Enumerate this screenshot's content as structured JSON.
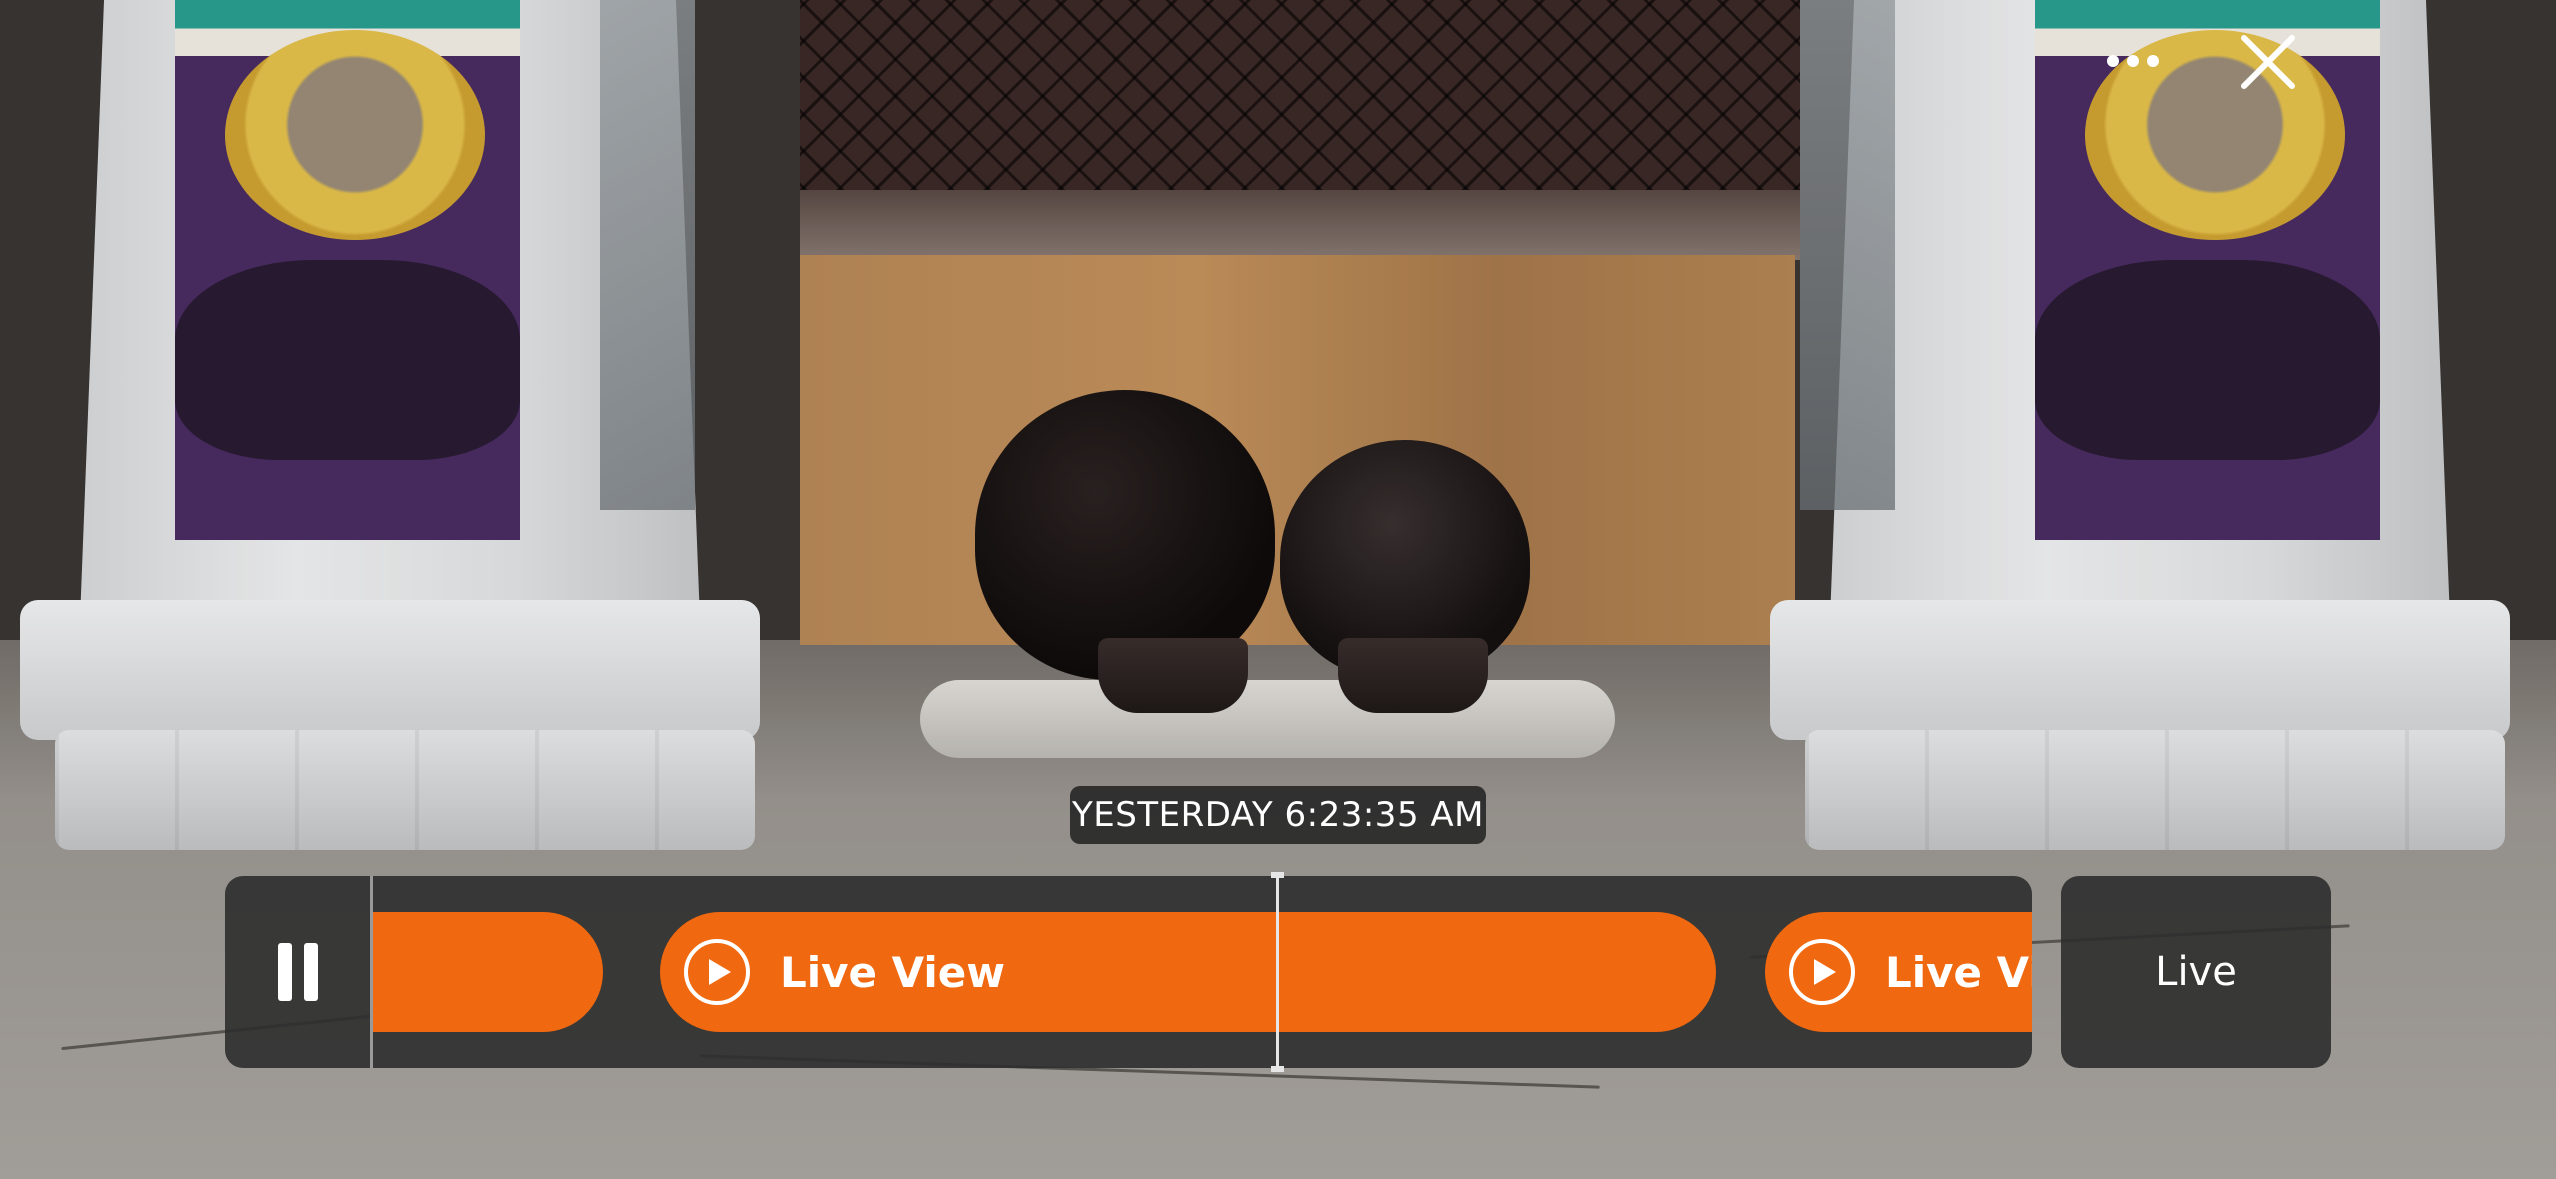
{
  "player": {
    "timestamp": "YESTERDAY 6:23:35 AM",
    "live_button_label": "Live",
    "accent_color": "#f0680f"
  },
  "timeline": {
    "clips": [
      {
        "label": ""
      },
      {
        "label": "Live View"
      },
      {
        "label": "Live Vi"
      }
    ]
  },
  "icons": {
    "menu": "more-horizontal-icon",
    "close": "close-icon",
    "pause": "pause-icon",
    "play": "play-circle-icon"
  }
}
